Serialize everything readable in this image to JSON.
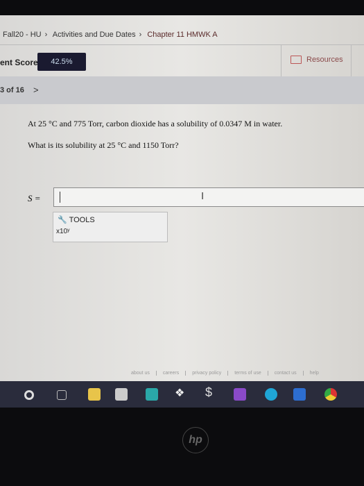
{
  "breadcrumb": [
    "Fall20 - HU",
    "Activities and Due Dates",
    "Chapter 11 HMWK A"
  ],
  "score": {
    "label": "ent Score:",
    "value": "42.5%"
  },
  "resources_label": "Resources",
  "nav": {
    "position": "3 of 16",
    "next": ">"
  },
  "question": {
    "line1": "At 25 °C and 775 Torr, carbon dioxide has a solubility of 0.0347 M in water.",
    "line2": "What is its solubility at 25 °C and 1150 Torr?"
  },
  "answer": {
    "label": "S =",
    "value": ""
  },
  "tools": {
    "label": "TOOLS",
    "x10": "x10ʸ"
  },
  "footer_links": [
    "about us",
    "careers",
    "privacy policy",
    "terms of use",
    "contact us",
    "help"
  ],
  "taskbar_icons": [
    "start-icon",
    "task-view-icon",
    "file-explorer-icon",
    "store-icon",
    "mail-icon",
    "dropbox-icon",
    "stripe-icon",
    "onenote-icon",
    "edge-icon",
    "word-icon",
    "chrome-icon"
  ],
  "brand": "hp"
}
